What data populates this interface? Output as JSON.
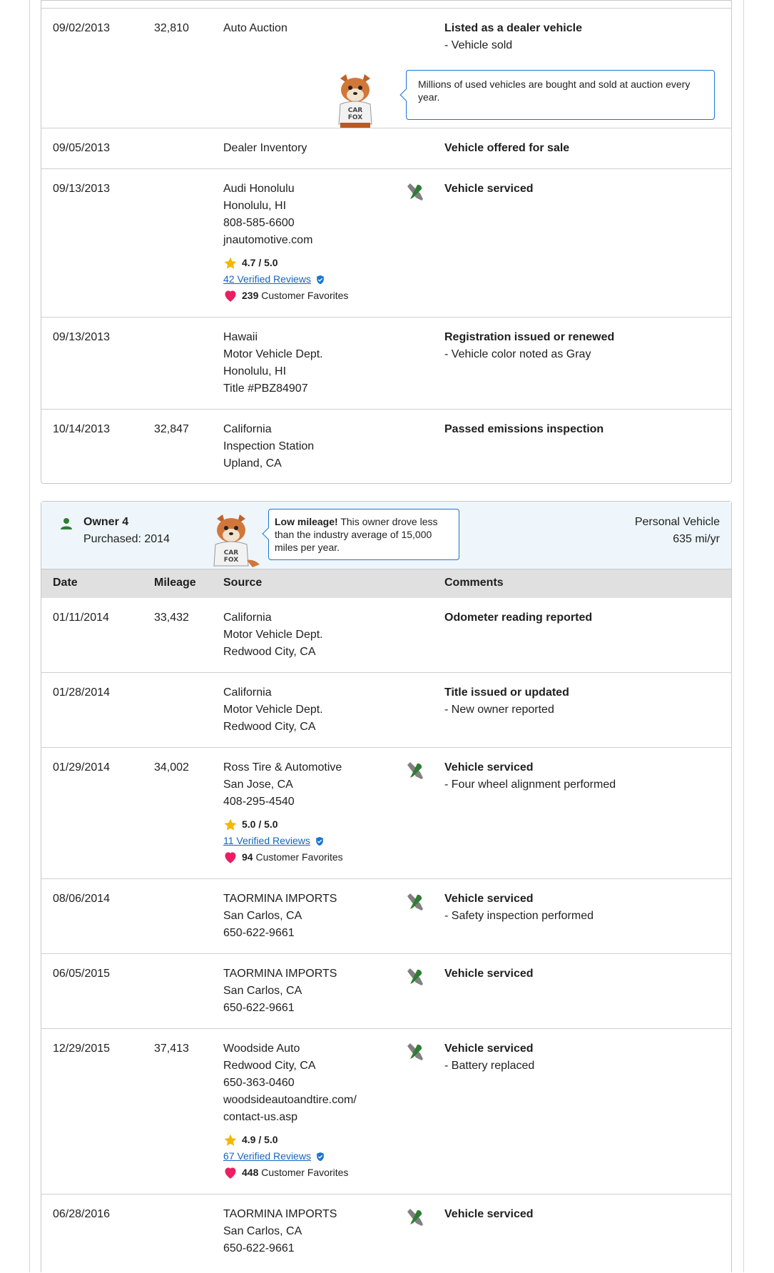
{
  "section1": {
    "tooltip": "Millions of used vehicles are bought and sold at auction every year.",
    "rows": [
      {
        "date": "09/02/2013",
        "mileage": "32,810",
        "source": [
          "Auto Auction"
        ],
        "comment_title": "Listed as a dealer vehicle",
        "comment_details": [
          "- Vehicle sold"
        ],
        "service": false
      },
      {
        "date": "09/05/2013",
        "mileage": "",
        "source": [
          "Dealer Inventory"
        ],
        "comment_title": "Vehicle offered for sale",
        "comment_details": [],
        "service": false
      },
      {
        "date": "09/13/2013",
        "mileage": "",
        "source": [
          "Audi Honolulu",
          "Honolulu, HI",
          "808-585-6600",
          "jnautomotive.com"
        ],
        "comment_title": "Vehicle serviced",
        "comment_details": [],
        "service": true,
        "rating": {
          "score": "4.7 / 5.0",
          "reviews": "42 Verified Reviews",
          "favorites_count": "239",
          "favorites_label": "Customer Favorites"
        }
      },
      {
        "date": "09/13/2013",
        "mileage": "",
        "source": [
          "Hawaii",
          "Motor Vehicle Dept.",
          "Honolulu, HI",
          "Title #PBZ84907"
        ],
        "comment_title": "Registration issued or renewed",
        "comment_details": [
          "- Vehicle color noted as Gray"
        ],
        "service": false
      },
      {
        "date": "10/14/2013",
        "mileage": "32,847",
        "source": [
          "California",
          "Inspection Station",
          "Upland, CA"
        ],
        "comment_title": "Passed emissions inspection",
        "comment_details": [],
        "service": false
      }
    ]
  },
  "owner4": {
    "owner_label": "Owner 4",
    "purchased": "Purchased: 2014",
    "tooltip_bold": "Low mileage!",
    "tooltip_text": " This owner drove less than the industry average of 15,000 miles per year.",
    "vehicle_type": "Personal Vehicle",
    "miles_per_year": "635 mi/yr",
    "columns": {
      "date": "Date",
      "mileage": "Mileage",
      "source": "Source",
      "comments": "Comments"
    },
    "rows": [
      {
        "date": "01/11/2014",
        "mileage": "33,432",
        "source": [
          "California",
          "Motor Vehicle Dept.",
          "Redwood City, CA"
        ],
        "comment_title": "Odometer reading reported",
        "comment_details": [],
        "service": false
      },
      {
        "date": "01/28/2014",
        "mileage": "",
        "source": [
          "California",
          "Motor Vehicle Dept.",
          "Redwood City, CA"
        ],
        "comment_title": "Title issued or updated",
        "comment_details": [
          "- New owner reported"
        ],
        "service": false
      },
      {
        "date": "01/29/2014",
        "mileage": "34,002",
        "source": [
          "Ross Tire & Automotive",
          "San Jose, CA",
          "408-295-4540"
        ],
        "comment_title": "Vehicle serviced",
        "comment_details": [
          "- Four wheel alignment performed"
        ],
        "service": true,
        "rating": {
          "score": "5.0 / 5.0",
          "reviews": "11 Verified Reviews",
          "favorites_count": "94",
          "favorites_label": "Customer Favorites"
        }
      },
      {
        "date": "08/06/2014",
        "mileage": "",
        "source": [
          "TAORMINA IMPORTS",
          "San Carlos, CA",
          "650-622-9661"
        ],
        "comment_title": "Vehicle serviced",
        "comment_details": [
          "- Safety inspection performed"
        ],
        "service": true
      },
      {
        "date": "06/05/2015",
        "mileage": "",
        "source": [
          "TAORMINA IMPORTS",
          "San Carlos, CA",
          "650-622-9661"
        ],
        "comment_title": "Vehicle serviced",
        "comment_details": [],
        "service": true
      },
      {
        "date": "12/29/2015",
        "mileage": "37,413",
        "source": [
          "Woodside Auto",
          "Redwood City, CA",
          "650-363-0460",
          "woodsideautoandtire.com/",
          "contact-us.asp"
        ],
        "comment_title": "Vehicle serviced",
        "comment_details": [
          "- Battery replaced"
        ],
        "service": true,
        "rating": {
          "score": "4.9 / 5.0",
          "reviews": "67 Verified Reviews",
          "favorites_count": "448",
          "favorites_label": "Customer Favorites"
        }
      },
      {
        "date": "06/28/2016",
        "mileage": "",
        "source": [
          "TAORMINA IMPORTS",
          "San Carlos, CA",
          "650-622-9661"
        ],
        "comment_title": "Vehicle serviced",
        "comment_details": [],
        "service": true
      }
    ]
  },
  "colors": {
    "accent": "#1976d2",
    "link": "#1565c0",
    "owner_icon": "#2e7d32",
    "header_bg": "#eef6fb",
    "col_head_bg": "#e0e0e0",
    "star": "#f5b700",
    "heart": "#e91e63"
  },
  "icons": {
    "service": "wrench-screwdriver-icon",
    "owner": "person-icon",
    "star": "star-icon",
    "heart": "heart-icon",
    "verified": "verified-check-icon",
    "mascot": "carfox-mascot"
  }
}
